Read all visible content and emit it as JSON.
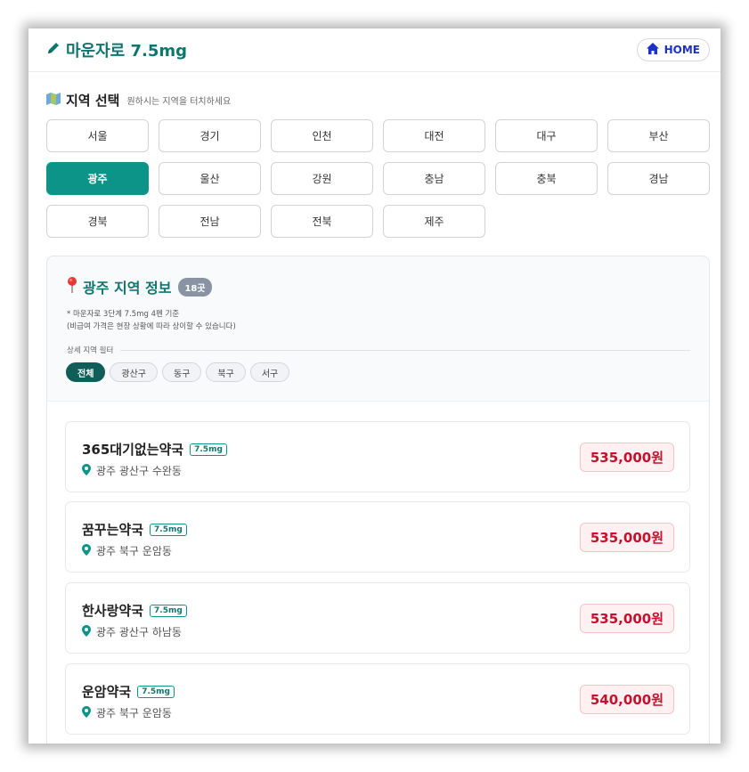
{
  "header": {
    "title": "마운자로 7.5mg",
    "home_label": "HOME"
  },
  "region_section": {
    "title": "지역 선택",
    "hint": "원하시는 지역을 터치하세요",
    "regions": [
      "서울",
      "경기",
      "인천",
      "대전",
      "대구",
      "부산",
      "광주",
      "울산",
      "강원",
      "충남",
      "충북",
      "경남",
      "경북",
      "전남",
      "전북",
      "제주"
    ],
    "selected": "광주"
  },
  "info_panel": {
    "title": "광주 지역 정보",
    "count_badge": "18곳",
    "note_1": "* 마운자로 3단계 7.5mg 4펜 기준",
    "note_2": "(비급여 가격은 현장 상황에 따라 상이할 수 있습니다)",
    "filter_label": "상세 지역 필터",
    "filters": [
      "전체",
      "광산구",
      "동구",
      "북구",
      "서구"
    ],
    "active_filter": "전체"
  },
  "pharmacies": [
    {
      "name": "365대기없는약국",
      "dose": "7.5mg",
      "location": "광주 광산구 수완동",
      "price": "535,000원"
    },
    {
      "name": "꿈꾸는약국",
      "dose": "7.5mg",
      "location": "광주 북구 운암동",
      "price": "535,000원"
    },
    {
      "name": "한사랑약국",
      "dose": "7.5mg",
      "location": "광주 광산구 하남동",
      "price": "535,000원"
    },
    {
      "name": "운암약국",
      "dose": "7.5mg",
      "location": "광주 북구 운암동",
      "price": "540,000원"
    }
  ],
  "colors": {
    "brand_teal": "#0d9488",
    "title_teal": "#0f766e",
    "home_blue": "#1d32c7",
    "price_red": "#c8102e",
    "price_bg": "#fff0f2"
  },
  "icons": {
    "title": "pencil-icon",
    "home": "home-icon",
    "region": "map-icon",
    "info": "pushpin-icon",
    "location": "location-pin-icon"
  }
}
